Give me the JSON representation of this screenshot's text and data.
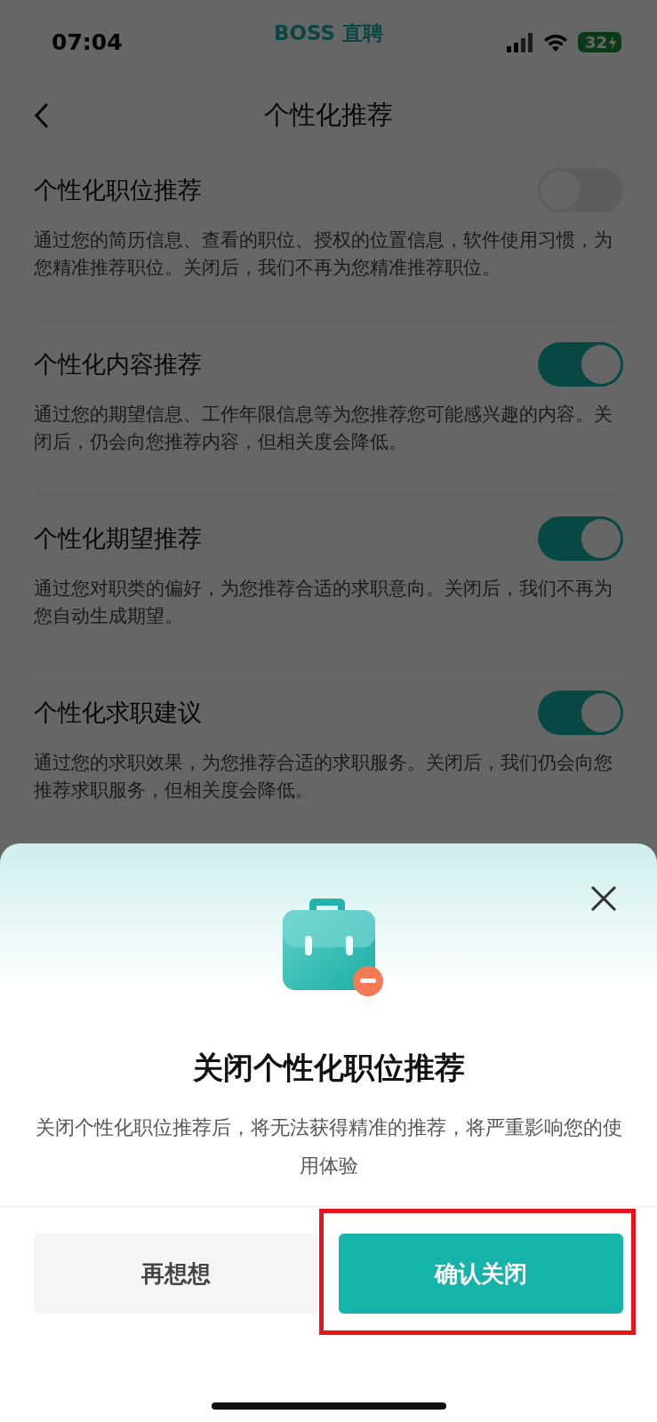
{
  "status_bar": {
    "time": "07:04",
    "app_label": "BOSS 直聘",
    "battery": "32"
  },
  "nav": {
    "title": "个性化推荐"
  },
  "settings": [
    {
      "title": "个性化职位推荐",
      "description": "通过您的简历信息、查看的职位、授权的位置信息，软件使用习惯，为您精准推荐职位。关闭后，我们不再为您精准推荐职位。",
      "on": false
    },
    {
      "title": "个性化内容推荐",
      "description": "通过您的期望信息、工作年限信息等为您推荐您可能感兴趣的内容。关闭后，仍会向您推荐内容，但相关度会降低。",
      "on": true
    },
    {
      "title": "个性化期望推荐",
      "description": "通过您对职类的偏好，为您推荐合适的求职意向。关闭后，我们不再为您自动生成期望。",
      "on": true
    },
    {
      "title": "个性化求职建议",
      "description": "通过您的求职效果，为您推荐合适的求职服务。关闭后，我们仍会向您推荐求职服务，但相关度会降低。",
      "on": true
    }
  ],
  "dialog": {
    "title": "关闭个性化职位推荐",
    "message": "关闭个性化职位推荐后，将无法获得精准的推荐，将严重影响您的使用体验",
    "buttons": [
      {
        "label": "再想想",
        "kind": "secondary",
        "highlighted": false
      },
      {
        "label": "确认关闭",
        "kind": "primary",
        "highlighted": true
      }
    ]
  }
}
